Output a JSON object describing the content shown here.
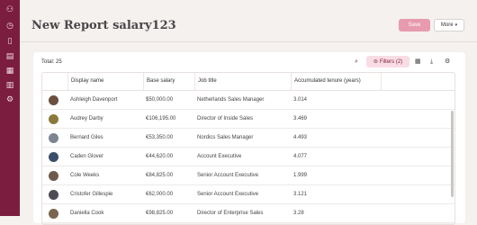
{
  "sidebar": {
    "icons": [
      "people-icon",
      "clock-icon",
      "document-icon",
      "clipboard-icon",
      "building-icon",
      "chart-icon",
      "settings-icon"
    ]
  },
  "header": {
    "title": "New Report salary123",
    "save_label": "Save",
    "more_label": "More"
  },
  "toolbar": {
    "total": "Total: 25",
    "filters_label": "Filters (2)"
  },
  "table": {
    "columns": [
      "Display name",
      "Base salary",
      "Job title",
      "Accumulated tenure (years)"
    ],
    "rows": [
      {
        "name": "Ashleigh Davenport",
        "salary": "$50,000.00",
        "job": "Netherlands Sales Manager",
        "tenure": "3.014",
        "avatar_color": "#6b4f3f"
      },
      {
        "name": "Audrey Darby",
        "salary": "€106,195.00",
        "job": "Director of Inside Sales",
        "tenure": "3.469",
        "avatar_color": "#8a7a3a"
      },
      {
        "name": "Bernard Giles",
        "salary": "€53,350.00",
        "job": "Nordics Sales Manager",
        "tenure": "4.493",
        "avatar_color": "#7c8590"
      },
      {
        "name": "Caden Glover",
        "salary": "€44,620.00",
        "job": "Account Executive",
        "tenure": "4.077",
        "avatar_color": "#3c4e6a"
      },
      {
        "name": "Cole Weeks",
        "salary": "€84,825.00",
        "job": "Senior Account Executive",
        "tenure": "1.999",
        "avatar_color": "#6d5a4c"
      },
      {
        "name": "Cristofer Gillespie",
        "salary": "€62,000.00",
        "job": "Senior Account Executive",
        "tenure": "3.121",
        "avatar_color": "#4f4a55"
      },
      {
        "name": "Daniella Cook",
        "salary": "€98,825.00",
        "job": "Director of Enterprise Sales",
        "tenure": "3.28",
        "avatar_color": "#7a6650"
      }
    ]
  }
}
